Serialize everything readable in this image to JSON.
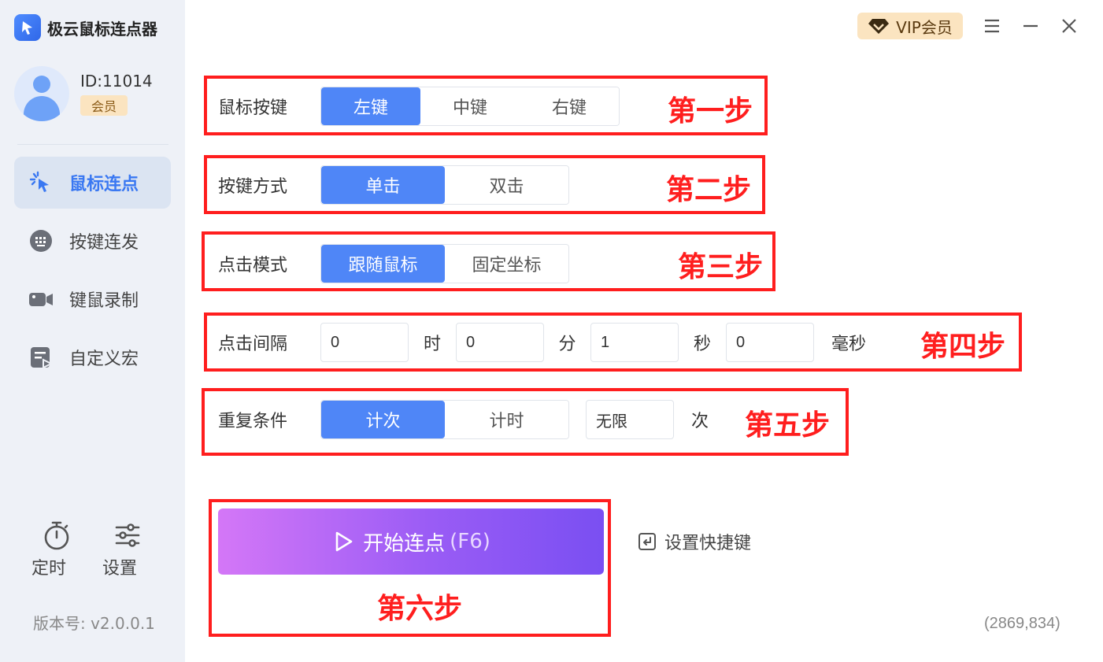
{
  "app": {
    "title": "极云鼠标连点器",
    "logo_icon": "cursor-icon",
    "brand_color": "#3a78f2"
  },
  "user": {
    "id": "ID:11014",
    "badge": "会员"
  },
  "nav": [
    {
      "label": "鼠标连点",
      "icon": "click-cursor-icon",
      "active": true
    },
    {
      "label": "按键连发",
      "icon": "keyboard-icon",
      "active": false
    },
    {
      "label": "键鼠录制",
      "icon": "video-camera-icon",
      "active": false
    },
    {
      "label": "自定义宏",
      "icon": "macro-document-icon",
      "active": false
    }
  ],
  "tools": [
    {
      "label": "定时",
      "icon": "stopwatch-icon"
    },
    {
      "label": "设置",
      "icon": "sliders-icon"
    }
  ],
  "version": "版本号: v2.0.0.1",
  "topbar": {
    "vip_label": "VIP会员"
  },
  "rows": {
    "mouse_button": {
      "label": "鼠标按键",
      "options": [
        "左键",
        "中键",
        "右键"
      ],
      "selected": "左键"
    },
    "click_type": {
      "label": "按键方式",
      "options": [
        "单击",
        "双击"
      ],
      "selected": "单击"
    },
    "click_mode": {
      "label": "点击模式",
      "options": [
        "跟随鼠标",
        "固定坐标"
      ],
      "selected": "跟随鼠标"
    },
    "interval": {
      "label": "点击间隔",
      "hours": "0",
      "hours_unit": "时",
      "minutes": "0",
      "minutes_unit": "分",
      "seconds": "1",
      "seconds_unit": "秒",
      "ms": "0",
      "ms_unit": "毫秒"
    },
    "repeat": {
      "label": "重复条件",
      "options": [
        "计次",
        "计时"
      ],
      "selected": "计次",
      "count": "无限",
      "count_unit": "次"
    }
  },
  "steps": [
    "第一步",
    "第二步",
    "第三步",
    "第四步",
    "第五步",
    "第六步"
  ],
  "start_button": {
    "label": "开始连点",
    "hotkey": "(F6)"
  },
  "shortcut_link": "设置快捷键",
  "coords": "(2869,834)",
  "colors": {
    "selected": "#4f86f7",
    "annotation_red": "#ff1e1e",
    "vip_bg": "#fbe4c0"
  }
}
